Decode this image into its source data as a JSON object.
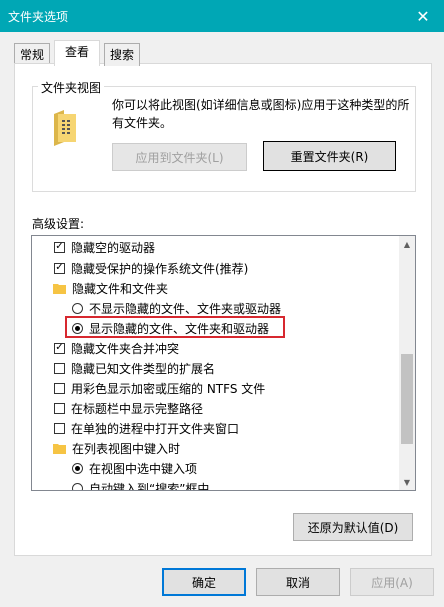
{
  "window": {
    "title": "文件夹选项",
    "close_glyph": "✕"
  },
  "tabs": [
    {
      "label": "常规",
      "active": false
    },
    {
      "label": "查看",
      "active": true
    },
    {
      "label": "搜索",
      "active": false
    }
  ],
  "folder_view": {
    "group_title": "文件夹视图",
    "description": "你可以将此视图(如详细信息或图标)应用于这种类型的所有文件夹。",
    "apply_label": "应用到文件夹(L)",
    "reset_label": "重置文件夹(R)"
  },
  "advanced": {
    "label": "高级设置:",
    "items": [
      {
        "type": "checkbox",
        "checked": true,
        "label": "隐藏空的驱动器"
      },
      {
        "type": "checkbox",
        "checked": true,
        "label": "隐藏受保护的操作系统文件(推荐)"
      },
      {
        "type": "folder",
        "label": "隐藏文件和文件夹"
      },
      {
        "type": "radio",
        "checked": false,
        "label": "不显示隐藏的文件、文件夹或驱动器"
      },
      {
        "type": "radio",
        "checked": true,
        "label": "显示隐藏的文件、文件夹和驱动器"
      },
      {
        "type": "checkbox",
        "checked": true,
        "label": "隐藏文件夹合并冲突"
      },
      {
        "type": "checkbox",
        "checked": false,
        "label": "隐藏已知文件类型的扩展名"
      },
      {
        "type": "checkbox",
        "checked": false,
        "label": "用彩色显示加密或压缩的 NTFS 文件"
      },
      {
        "type": "checkbox",
        "checked": false,
        "label": "在标题栏中显示完整路径"
      },
      {
        "type": "checkbox",
        "checked": false,
        "label": "在单独的进程中打开文件夹窗口"
      },
      {
        "type": "folder",
        "label": "在列表视图中键入时"
      },
      {
        "type": "radio",
        "checked": true,
        "label": "在视图中选中键入项"
      },
      {
        "type": "radio",
        "checked": false,
        "label": "自动键入到“搜索”框中"
      }
    ],
    "restore_label": "还原为默认值(D)"
  },
  "footer": {
    "ok_label": "确定",
    "cancel_label": "取消",
    "apply_label": "应用(A)"
  },
  "colors": {
    "titlebar": "#00a7b5",
    "highlight": "#d7282f",
    "focus": "#0078d7"
  }
}
